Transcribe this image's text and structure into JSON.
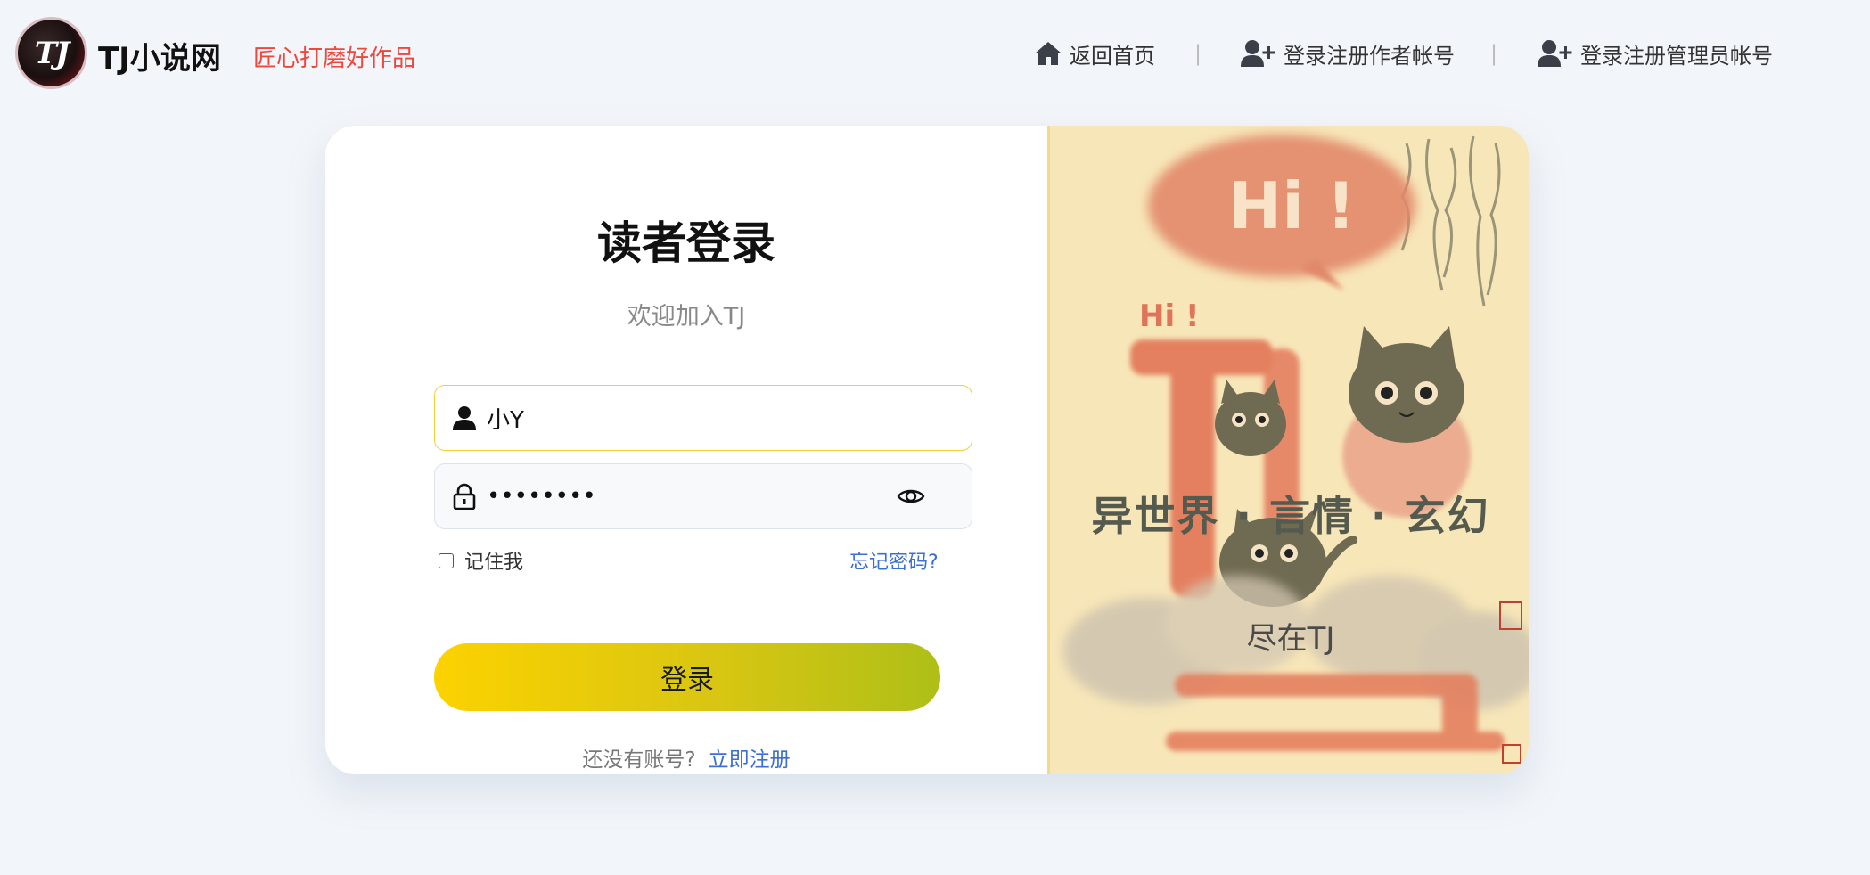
{
  "header": {
    "logo_text": "TJ",
    "site_name": "TJ小说网",
    "slogan": "匠心打磨好作品",
    "nav": [
      {
        "label": "返回首页",
        "icon": "home-icon"
      },
      {
        "label": "登录注册作者帐号",
        "icon": "user-plus-icon"
      },
      {
        "label": "登录注册管理员帐号",
        "icon": "user-plus-icon"
      }
    ],
    "separator": "|"
  },
  "login": {
    "title": "读者登录",
    "subtitle": "欢迎加入TJ",
    "username_value": "小Y",
    "password_value": "••••••••",
    "remember_label": "记住我",
    "forgot_label": "忘记密码?",
    "submit_label": "登录",
    "no_account_text": "还没有账号?",
    "register_label": "立即注册"
  },
  "art_panel": {
    "bubble_text_large": "Hi !",
    "bubble_text_small": "Hi !",
    "logo_letters": "TJ",
    "genres": "异世界 · 言情 · 玄幻",
    "tagline": "尽在TJ"
  },
  "colors": {
    "accent_yellow": "#fcd200",
    "accent_green": "#aebf17",
    "slogan_red": "#f0473d",
    "link_blue": "#3b6fd4",
    "panel_bg": "#f7e6b8"
  }
}
